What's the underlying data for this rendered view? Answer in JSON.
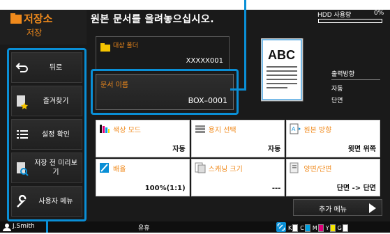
{
  "header": {
    "mode_title": "저장소",
    "mode_sub": "저장",
    "instruction": "원본 문서를 올려놓으십시오.",
    "hdd_label": "HDD 사용량",
    "hdd_value": "0%"
  },
  "sidebar": {
    "items": [
      {
        "label": "뒤로"
      },
      {
        "label": "즐겨찾기"
      },
      {
        "label": "설정 확인"
      },
      {
        "label": "저장 전 미리보기"
      },
      {
        "label": "사용자 메뉴"
      }
    ]
  },
  "folder": {
    "label": "대상 폴더",
    "value": "XXXXX001"
  },
  "filename": {
    "label": "문서 이름",
    "value": "BOX–0001"
  },
  "preview": {
    "text": "ABC"
  },
  "output": {
    "title": "출력방향",
    "line1": "자동",
    "line2": "단면"
  },
  "settings": [
    {
      "label": "색상 모드",
      "value": "자동",
      "icon": "color-mode-icon"
    },
    {
      "label": "용지 선택",
      "value": "자동",
      "icon": "paper-select-icon"
    },
    {
      "label": "원본 방향",
      "value": "윗면 위쪽",
      "icon": "original-orientation-icon"
    },
    {
      "label": "배율",
      "value": "100%(1:1)",
      "icon": "zoom-icon"
    },
    {
      "label": "스캐닝 크기",
      "value": "---",
      "icon": "scan-size-icon"
    },
    {
      "label": "양면/단면",
      "value": "단면 -> 단면",
      "icon": "duplex-icon"
    }
  ],
  "more_menu": {
    "label": "추가 메뉴"
  },
  "status": {
    "user": "J.Smith",
    "text": "유휴",
    "toner": [
      {
        "name": "K",
        "color": "#ffffff"
      },
      {
        "name": "C",
        "color": "#00a0e0"
      },
      {
        "name": "M",
        "color": "#e0007a"
      },
      {
        "name": "Y",
        "color": "#f5e400"
      },
      {
        "name": "G",
        "color": "#ffffff"
      }
    ]
  },
  "colors": {
    "accent": "#f08a1c",
    "highlight": "#0a8fd6"
  }
}
